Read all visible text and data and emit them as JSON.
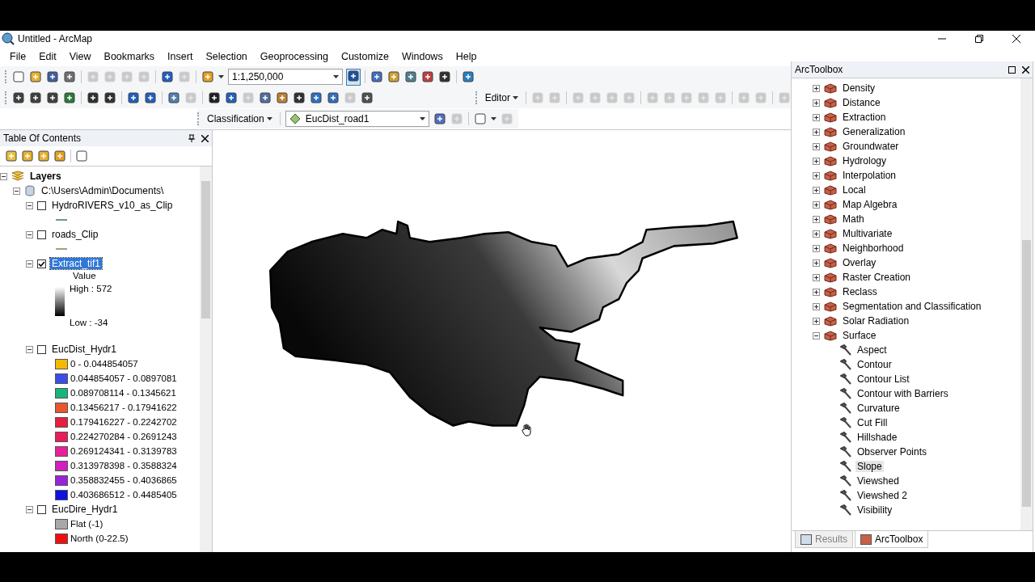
{
  "window": {
    "title": "Untitled - ArcMap"
  },
  "menu": [
    "File",
    "Edit",
    "View",
    "Bookmarks",
    "Insert",
    "Selection",
    "Geoprocessing",
    "Customize",
    "Windows",
    "Help"
  ],
  "toolbar": {
    "scale": "1:1,250,000",
    "editor": "Editor",
    "classification": "Classification",
    "layer": "EucDist_road1"
  },
  "toc": {
    "title": "Table Of Contents",
    "tree": [
      {
        "kind": "layers",
        "label": "Layers",
        "expanded": true,
        "children": [
          {
            "kind": "database",
            "label": "C:\\Users\\Admin\\Documents\\",
            "expanded": true,
            "children": [
              {
                "kind": "layer",
                "label": "HydroRIVERS_v10_as_Clip",
                "expanded": true,
                "checked": false,
                "selected": false,
                "legend": [
                  {
                    "kind": "line",
                    "color": "#6a9a88"
                  }
                ]
              },
              {
                "kind": "layer",
                "label": "roads_Clip",
                "expanded": true,
                "checked": false,
                "selected": false,
                "legend": [
                  {
                    "kind": "line",
                    "color": "#a89a80"
                  }
                ]
              },
              {
                "kind": "layer",
                "label": "Extract_tif1",
                "expanded": true,
                "checked": true,
                "selected": true,
                "legend": [
                  {
                    "kind": "ramp",
                    "heading": "Value",
                    "high": "High : 572",
                    "low": "Low : -34"
                  }
                ]
              },
              {
                "kind": "layer",
                "label": "EucDist_Hydr1",
                "expanded": true,
                "checked": false,
                "selected": false,
                "legend": [
                  {
                    "kind": "class",
                    "color": "#f5b800",
                    "label": "0 - 0.044854057"
                  },
                  {
                    "kind": "class",
                    "color": "#3b4ee8",
                    "label": "0.044854057 - 0.0897081"
                  },
                  {
                    "kind": "class",
                    "color": "#18b57a",
                    "label": "0.089708114 - 0.1345621"
                  },
                  {
                    "kind": "class",
                    "color": "#e8582a",
                    "label": "0.13456217 - 0.17941622"
                  },
                  {
                    "kind": "class",
                    "color": "#e81d3f",
                    "label": "0.179416227 - 0.2242702"
                  },
                  {
                    "kind": "class",
                    "color": "#e81d5a",
                    "label": "0.224270284 - 0.2691243"
                  },
                  {
                    "kind": "class",
                    "color": "#e8209a",
                    "label": "0.269124341 - 0.3139783"
                  },
                  {
                    "kind": "class",
                    "color": "#d020c0",
                    "label": "0.313978398 - 0.3588324"
                  },
                  {
                    "kind": "class",
                    "color": "#9a22d8",
                    "label": "0.358832455 - 0.4036865"
                  },
                  {
                    "kind": "class",
                    "color": "#1010e0",
                    "label": "0.403686512 - 0.4485405"
                  }
                ]
              },
              {
                "kind": "layer",
                "label": "EucDire_Hydr1",
                "expanded": true,
                "checked": false,
                "selected": false,
                "legend": [
                  {
                    "kind": "class",
                    "color": "#a8a8a8",
                    "label": "Flat (-1)"
                  },
                  {
                    "kind": "class",
                    "color": "#ee1010",
                    "label": "North (0-22.5)"
                  }
                ]
              }
            ]
          }
        ]
      }
    ]
  },
  "toolbox": {
    "title": "ArcToolbox",
    "items": [
      {
        "label": "Density",
        "expanded": false
      },
      {
        "label": "Distance",
        "expanded": false
      },
      {
        "label": "Extraction",
        "expanded": false
      },
      {
        "label": "Generalization",
        "expanded": false
      },
      {
        "label": "Groundwater",
        "expanded": false
      },
      {
        "label": "Hydrology",
        "expanded": false
      },
      {
        "label": "Interpolation",
        "expanded": false
      },
      {
        "label": "Local",
        "expanded": false
      },
      {
        "label": "Map Algebra",
        "expanded": false
      },
      {
        "label": "Math",
        "expanded": false
      },
      {
        "label": "Multivariate",
        "expanded": false
      },
      {
        "label": "Neighborhood",
        "expanded": false
      },
      {
        "label": "Overlay",
        "expanded": false
      },
      {
        "label": "Raster Creation",
        "expanded": false
      },
      {
        "label": "Reclass",
        "expanded": false
      },
      {
        "label": "Segmentation and Classification",
        "expanded": false
      },
      {
        "label": "Solar Radiation",
        "expanded": false
      },
      {
        "label": "Surface",
        "expanded": true,
        "children": [
          {
            "label": "Aspect",
            "selected": false
          },
          {
            "label": "Contour",
            "selected": false
          },
          {
            "label": "Contour List",
            "selected": false
          },
          {
            "label": "Contour with Barriers",
            "selected": false
          },
          {
            "label": "Curvature",
            "selected": false
          },
          {
            "label": "Cut Fill",
            "selected": false
          },
          {
            "label": "Hillshade",
            "selected": false
          },
          {
            "label": "Observer Points",
            "selected": false
          },
          {
            "label": "Slope",
            "selected": true
          },
          {
            "label": "Viewshed",
            "selected": false
          },
          {
            "label": "Viewshed 2",
            "selected": false
          },
          {
            "label": "Visibility",
            "selected": false
          }
        ]
      }
    ],
    "tabs": [
      {
        "label": "Results",
        "selected": false
      },
      {
        "label": "ArcToolbox",
        "selected": true
      }
    ]
  }
}
